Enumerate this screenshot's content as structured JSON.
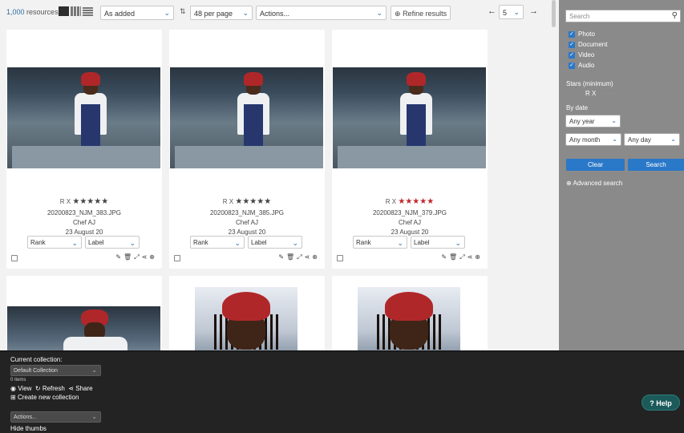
{
  "topbar": {
    "resource_count": "1,000",
    "resource_label": "resources",
    "sort_order": "As added",
    "per_page": "48 per page",
    "actions": "Actions...",
    "refine": "Refine results",
    "page": "5"
  },
  "cards": [
    {
      "rating_prefix": "R X",
      "stars": "★★★★★",
      "filename": "20200823_NJM_383.JPG",
      "title": "Chef AJ",
      "date": "23 August 20",
      "rank": "Rank",
      "label": "Label",
      "stars_colored": false
    },
    {
      "rating_prefix": "R X",
      "stars": "★★★★★",
      "filename": "20200823_NJM_385.JPG",
      "title": "Chef AJ",
      "date": "23 August 20",
      "rank": "Rank",
      "label": "Label",
      "stars_colored": false
    },
    {
      "rating_prefix": "R X",
      "stars": "★★★★★",
      "filename": "20200823_NJM_379.JPG",
      "title": "Chef AJ",
      "date": "23 August 20",
      "rank": "Rank",
      "label": "Label",
      "stars_colored": true
    }
  ],
  "sidebar": {
    "search_placeholder": "Search",
    "filters": [
      "Photo",
      "Document",
      "Video",
      "Audio"
    ],
    "stars_label": "Stars (minimum)",
    "stars_clear": "R X",
    "by_date_label": "By date",
    "any_year": "Any year",
    "any_month": "Any month",
    "any_day": "Any day",
    "clear_button": "Clear",
    "search_button": "Search",
    "advanced_search": "Advanced search"
  },
  "collection": {
    "current_label": "Current collection:",
    "selected": "Default Collection",
    "item_count": "0 items",
    "view": "View",
    "refresh": "Refresh",
    "share": "Share",
    "create": "Create new collection",
    "actions": "Actions...",
    "hide_thumbs": "Hide thumbs"
  },
  "help": "Help",
  "colors": {
    "accent": "#2a78c8",
    "star_red": "#c0282d",
    "sidebar_bg": "#8a8a8a",
    "bottom_bg": "#232323"
  }
}
